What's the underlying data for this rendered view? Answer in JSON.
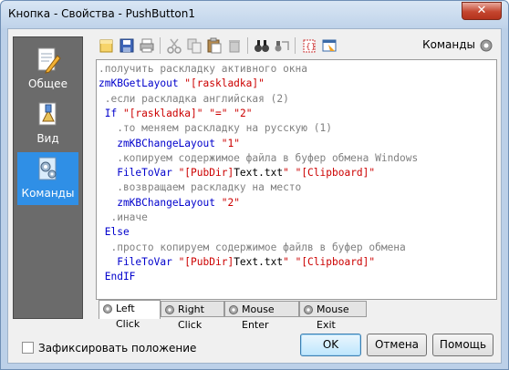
{
  "window": {
    "title": "Кнопка - Свойства - PushButton1",
    "close_label": "✕"
  },
  "sidebar": {
    "items": [
      {
        "label": "Общее",
        "icon": "pencil-paper-icon",
        "active": false
      },
      {
        "label": "Вид",
        "icon": "paint-icon",
        "active": false
      },
      {
        "label": "Команды",
        "icon": "gears-icon",
        "active": true
      }
    ]
  },
  "toolbar": {
    "icons": [
      "new-icon",
      "save-icon",
      "print-icon",
      "cut-icon",
      "copy-icon",
      "paste-icon",
      "delete-icon",
      "find-icon",
      "replace-icon",
      "insert-command-icon",
      "assistant-icon"
    ],
    "commands_label": "Команды"
  },
  "editor": {
    "lines": [
      [
        {
          "t": ".получить раскладку активного окна",
          "c": "comment"
        }
      ],
      [
        {
          "t": "zmKBGetLayout ",
          "c": "kw"
        },
        {
          "t": "\"[raskladka]\"",
          "c": "str"
        }
      ],
      [
        {
          "t": " .если раскладка английская (2)",
          "c": "comment"
        }
      ],
      [
        {
          "t": " If ",
          "c": "kw"
        },
        {
          "t": "\"[raskladka]\"",
          "c": "str"
        },
        {
          "t": " ",
          "c": "norm"
        },
        {
          "t": "\"=\"",
          "c": "str"
        },
        {
          "t": " ",
          "c": "norm"
        },
        {
          "t": "\"2\"",
          "c": "str"
        }
      ],
      [
        {
          "t": "   .то меняем раскладку на русскую (1)",
          "c": "comment"
        }
      ],
      [
        {
          "t": "   zmKBChangeLayout ",
          "c": "kw"
        },
        {
          "t": "\"1\"",
          "c": "str"
        }
      ],
      [
        {
          "t": "   .копируем содержимое файла в буфер обмена Windows",
          "c": "comment"
        }
      ],
      [
        {
          "t": "   FileToVar ",
          "c": "kw"
        },
        {
          "t": "\"[PubDir]",
          "c": "str"
        },
        {
          "t": "Text.txt",
          "c": "norm"
        },
        {
          "t": "\"",
          "c": "str"
        },
        {
          "t": " ",
          "c": "norm"
        },
        {
          "t": "\"[Clipboard]\"",
          "c": "str"
        }
      ],
      [
        {
          "t": "   .возвращаем раскладку на место",
          "c": "comment"
        }
      ],
      [
        {
          "t": "   zmKBChangeLayout ",
          "c": "kw"
        },
        {
          "t": "\"2\"",
          "c": "str"
        }
      ],
      [
        {
          "t": "  .иначе",
          "c": "comment"
        }
      ],
      [
        {
          "t": " Else",
          "c": "kw"
        }
      ],
      [
        {
          "t": "  .просто копируем содержимое файлв в буфер обмена",
          "c": "comment"
        }
      ],
      [
        {
          "t": "   FileToVar ",
          "c": "kw"
        },
        {
          "t": "\"[PubDir]",
          "c": "str"
        },
        {
          "t": "Text.txt",
          "c": "norm"
        },
        {
          "t": "\"",
          "c": "str"
        },
        {
          "t": " ",
          "c": "norm"
        },
        {
          "t": "\"[Clipboard]\"",
          "c": "str"
        }
      ],
      [
        {
          "t": " EndIF",
          "c": "kw"
        }
      ]
    ]
  },
  "tabs": [
    {
      "label": "Left Click",
      "active": true
    },
    {
      "label": "Right Click",
      "active": false
    },
    {
      "label": "Mouse Enter",
      "active": false
    },
    {
      "label": "Mouse Exit",
      "active": false
    }
  ],
  "footer": {
    "lock_position_label": "Зафиксировать положение",
    "lock_position_checked": false,
    "ok_label": "OK",
    "cancel_label": "Отмена",
    "help_label": "Помощь"
  },
  "colors": {
    "comment": "#808080",
    "keyword": "#0000cc",
    "string": "#cc0000",
    "sidebar_active": "#2f8fe6"
  }
}
